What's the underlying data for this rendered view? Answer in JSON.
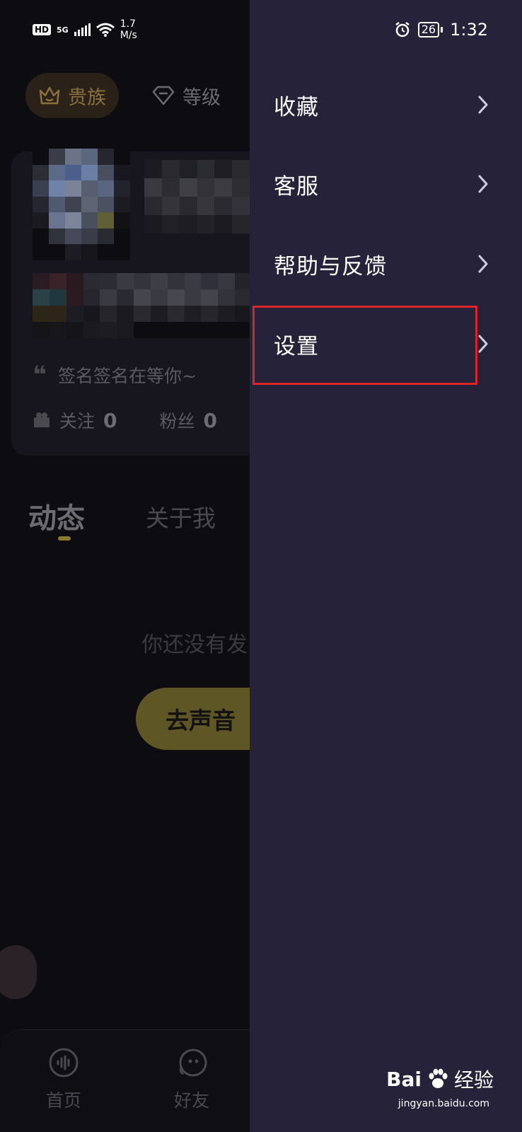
{
  "status": {
    "left": {
      "hd": "HD",
      "net": "5G",
      "speed_value": "1.7",
      "speed_unit": "M/s"
    },
    "right": {
      "battery": "26",
      "time": "1:32"
    }
  },
  "profile": {
    "chips": [
      {
        "label": "贵族"
      },
      {
        "label": "等级"
      }
    ],
    "signature": "签名签名在等你~",
    "stats": {
      "follow_label": "关注",
      "follow_count": "0",
      "fans_label": "粉丝",
      "fans_count": "0"
    }
  },
  "tabs": [
    {
      "label": "动态"
    },
    {
      "label": "关于我"
    }
  ],
  "empty_state": {
    "text": "你还没有发",
    "button": "去声音"
  },
  "bottom_nav": [
    {
      "label": "首页"
    },
    {
      "label": "好友"
    }
  ],
  "drawer": {
    "items": [
      {
        "label": "收藏"
      },
      {
        "label": "客服"
      },
      {
        "label": "帮助与反馈"
      },
      {
        "label": "设置"
      }
    ],
    "highlighted_item": "设置"
  },
  "watermark": {
    "brand": "Bai",
    "brand2": "经验",
    "url": "jingyan.baidu.com"
  },
  "colors": {
    "drawer_bg": "#25223a",
    "highlight": "#d9242a",
    "accent_gold": "#5f5625"
  }
}
